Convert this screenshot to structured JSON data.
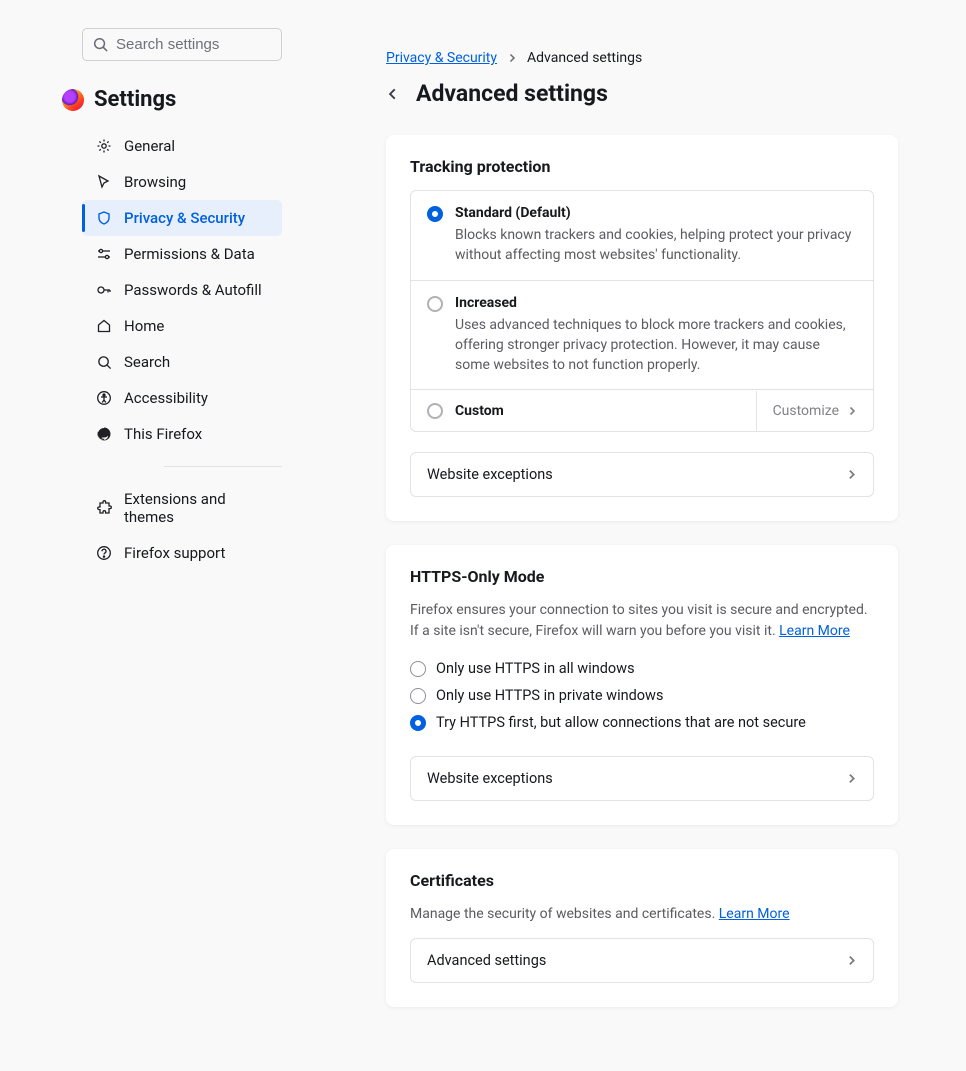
{
  "search": {
    "placeholder": "Search settings"
  },
  "brand": {
    "title": "Settings"
  },
  "sidebar": {
    "items": [
      {
        "label": "General"
      },
      {
        "label": "Browsing"
      },
      {
        "label": "Privacy & Security"
      },
      {
        "label": "Permissions & Data"
      },
      {
        "label": "Passwords & Autofill"
      },
      {
        "label": "Home"
      },
      {
        "label": "Search"
      },
      {
        "label": "Accessibility"
      },
      {
        "label": "This Firefox"
      }
    ],
    "secondary": [
      {
        "label": "Extensions and themes"
      },
      {
        "label": "Firefox support"
      }
    ]
  },
  "breadcrumbs": {
    "parent": "Privacy & Security",
    "current": "Advanced settings"
  },
  "page_title": "Advanced settings",
  "tracking": {
    "heading": "Tracking protection",
    "options": [
      {
        "title": "Standard (Default)",
        "desc": "Blocks known trackers and cookies, helping protect your privacy without affecting most websites' functionality."
      },
      {
        "title": "Increased",
        "desc": "Uses advanced techniques to block more trackers and cookies, offering stronger privacy protection. However, it may cause some websites to not function properly."
      },
      {
        "title": "Custom"
      }
    ],
    "customize_label": "Customize",
    "exceptions_label": "Website exceptions"
  },
  "https": {
    "heading": "HTTPS-Only Mode",
    "desc": "Firefox ensures your connection to sites you visit is secure and encrypted. If a site isn't secure, Firefox will warn you before you visit it.",
    "learn_more": "Learn More",
    "options": [
      "Only use HTTPS in all windows",
      "Only use HTTPS in private windows",
      "Try HTTPS first, but allow connections that are not secure"
    ],
    "exceptions_label": "Website exceptions"
  },
  "certs": {
    "heading": "Certificates",
    "desc": "Manage the security of websites and certificates.",
    "learn_more": "Learn More",
    "advanced_label": "Advanced settings"
  }
}
